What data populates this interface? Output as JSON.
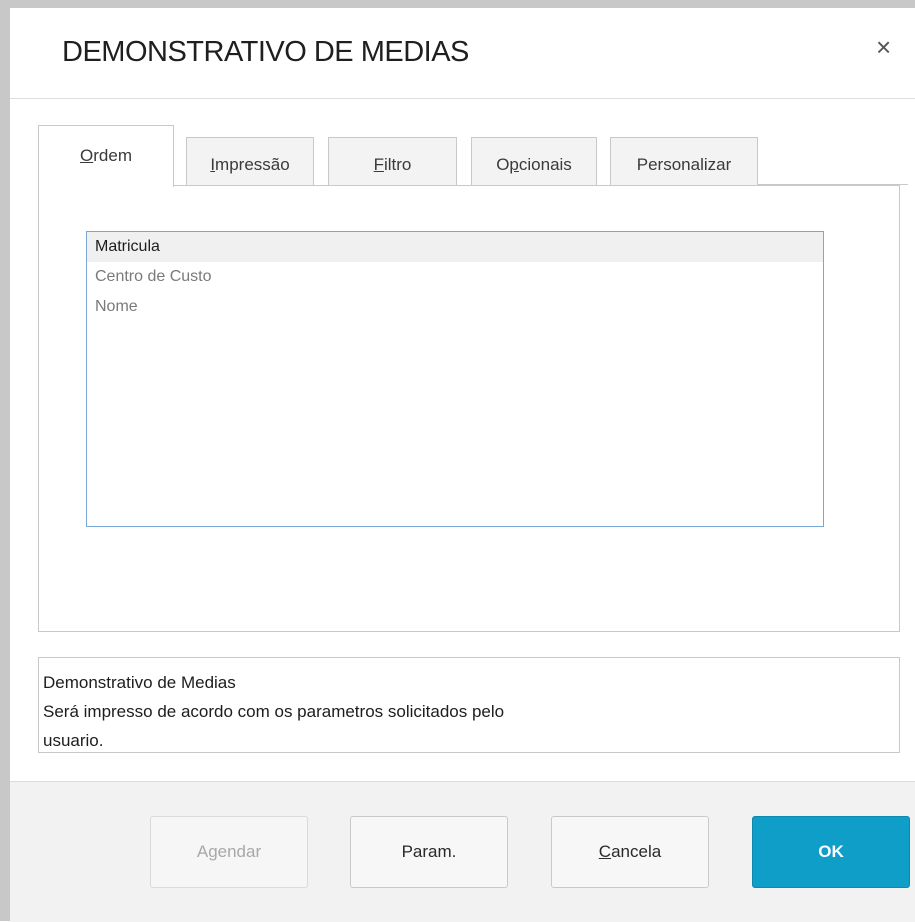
{
  "dialog": {
    "title": "DEMONSTRATIVO DE MEDIAS",
    "close_icon": "×"
  },
  "tabs": [
    {
      "label": "Ordem",
      "mnemonic": "O",
      "rest": "rdem",
      "active": true
    },
    {
      "label": "Impressão",
      "mnemonic": "I",
      "rest": "mpressão",
      "active": false
    },
    {
      "label": "Filtro",
      "mnemonic": "F",
      "rest": "iltro",
      "active": false
    },
    {
      "label": "Opcionais",
      "mnemonic_prefix": "O",
      "mnemonic": "p",
      "rest": "cionais",
      "active": false
    },
    {
      "label": "Personalizar",
      "active": false
    }
  ],
  "order_list": {
    "items": [
      "Matricula",
      "Centro de Custo",
      "Nome"
    ],
    "selected": "Matricula"
  },
  "description": {
    "lines": [
      "Demonstrativo de Medias",
      "Será impresso de acordo com os parametros solicitados pelo",
      "usuario."
    ]
  },
  "buttons": {
    "schedule": "Agendar",
    "params": "Param.",
    "cancel_mnemonic": "C",
    "cancel_rest": "ancela",
    "ok": "OK"
  },
  "colors": {
    "primary": "#0f9ec7",
    "list_border": "#7aa7d8"
  }
}
